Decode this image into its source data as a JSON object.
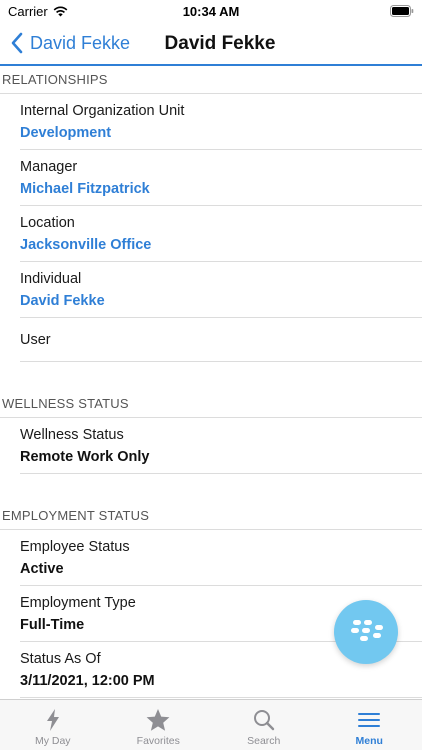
{
  "status_bar": {
    "carrier": "Carrier",
    "time": "10:34 AM"
  },
  "nav": {
    "back_label": "David Fekke",
    "title": "David Fekke"
  },
  "sections": {
    "relationships": {
      "header": "RELATIONSHIPS",
      "rows": [
        {
          "label": "Internal Organization Unit",
          "value": "Development"
        },
        {
          "label": "Manager",
          "value": "Michael Fitzpatrick"
        },
        {
          "label": "Location",
          "value": "Jacksonville Office"
        },
        {
          "label": "Individual",
          "value": "David Fekke"
        },
        {
          "label": "User"
        }
      ]
    },
    "wellness": {
      "header": "WELLNESS STATUS",
      "rows": [
        {
          "label": "Wellness Status",
          "value": "Remote Work Only"
        }
      ]
    },
    "employment": {
      "header": "EMPLOYMENT STATUS",
      "rows": [
        {
          "label": "Employee Status",
          "value": "Active"
        },
        {
          "label": "Employment Type",
          "value": "Full-Time"
        },
        {
          "label": "Status As Of",
          "value": "3/11/2021, 12:00 PM"
        }
      ]
    }
  },
  "tabs": [
    {
      "label": "My Day",
      "icon": "bolt-icon"
    },
    {
      "label": "Favorites",
      "icon": "star-icon"
    },
    {
      "label": "Search",
      "icon": "search-icon"
    },
    {
      "label": "Menu",
      "icon": "menu-icon",
      "active": true
    }
  ],
  "colors": {
    "accent": "#2f7fd6",
    "fab": "#72c8f0",
    "tab_inactive": "#8e8e93"
  }
}
